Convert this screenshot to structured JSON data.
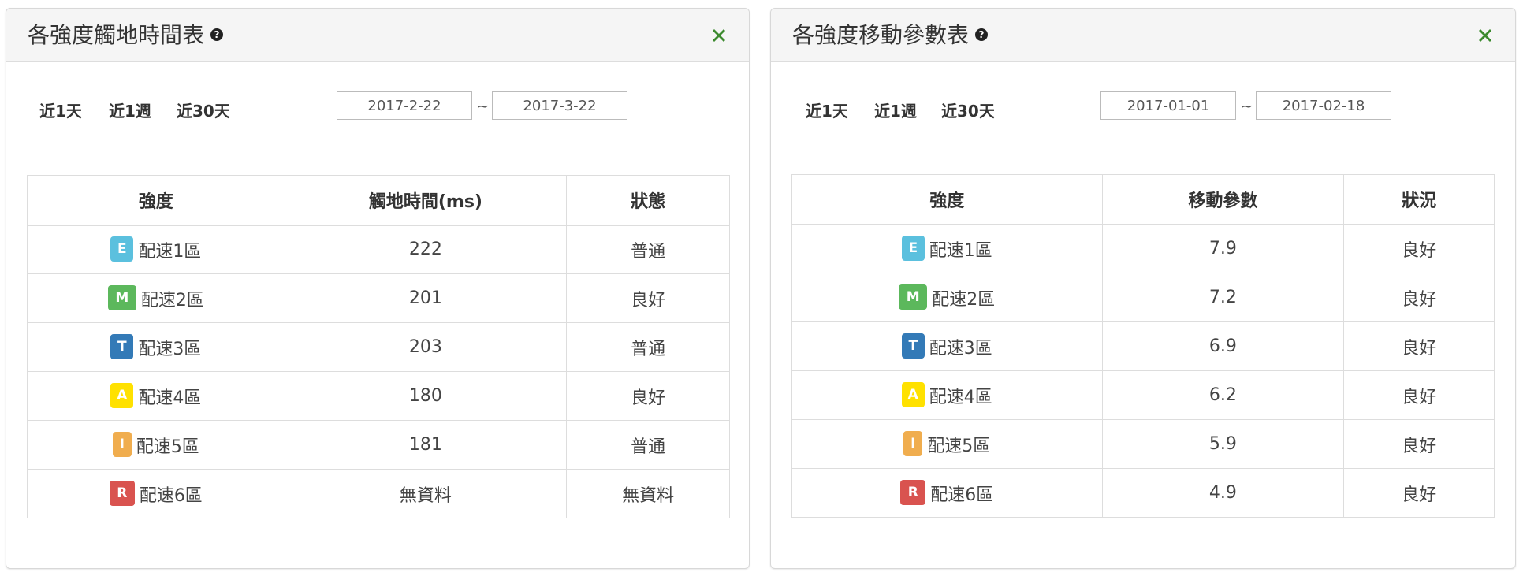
{
  "colors": {
    "E": "#5bc0de",
    "M": "#5cb85c",
    "T": "#337ab7",
    "A": "#ffe100",
    "I": "#f0ad4e",
    "R": "#d9534f",
    "close_icon": "#3c8a2e"
  },
  "left_panel": {
    "title": "各強度觸地時間表",
    "help_icon": "?",
    "close_icon": "close-x-icon",
    "quick_links": [
      "近1天",
      "近1週",
      "近30天"
    ],
    "date_from": "2017-2-22",
    "date_separator": "~",
    "date_to": "2017-3-22",
    "table": {
      "headers": [
        "強度",
        "觸地時間(ms)",
        "狀態"
      ],
      "rows": [
        {
          "badge": "E",
          "zone": "配速1區",
          "value": "222",
          "status": "普通"
        },
        {
          "badge": "M",
          "zone": "配速2區",
          "value": "201",
          "status": "良好"
        },
        {
          "badge": "T",
          "zone": "配速3區",
          "value": "203",
          "status": "普通"
        },
        {
          "badge": "A",
          "zone": "配速4區",
          "value": "180",
          "status": "良好"
        },
        {
          "badge": "I",
          "zone": "配速5區",
          "value": "181",
          "status": "普通"
        },
        {
          "badge": "R",
          "zone": "配速6區",
          "value": "無資料",
          "status": "無資料"
        }
      ]
    }
  },
  "right_panel": {
    "title": "各強度移動參數表",
    "help_icon": "?",
    "close_icon": "close-x-icon",
    "quick_links": [
      "近1天",
      "近1週",
      "近30天"
    ],
    "date_from": "2017-01-01",
    "date_separator": "~",
    "date_to": "2017-02-18",
    "table": {
      "headers": [
        "強度",
        "移動參數",
        "狀況"
      ],
      "rows": [
        {
          "badge": "E",
          "zone": "配速1區",
          "value": "7.9",
          "status": "良好"
        },
        {
          "badge": "M",
          "zone": "配速2區",
          "value": "7.2",
          "status": "良好"
        },
        {
          "badge": "T",
          "zone": "配速3區",
          "value": "6.9",
          "status": "良好"
        },
        {
          "badge": "A",
          "zone": "配速4區",
          "value": "6.2",
          "status": "良好"
        },
        {
          "badge": "I",
          "zone": "配速5區",
          "value": "5.9",
          "status": "良好"
        },
        {
          "badge": "R",
          "zone": "配速6區",
          "value": "4.9",
          "status": "良好"
        }
      ]
    }
  }
}
